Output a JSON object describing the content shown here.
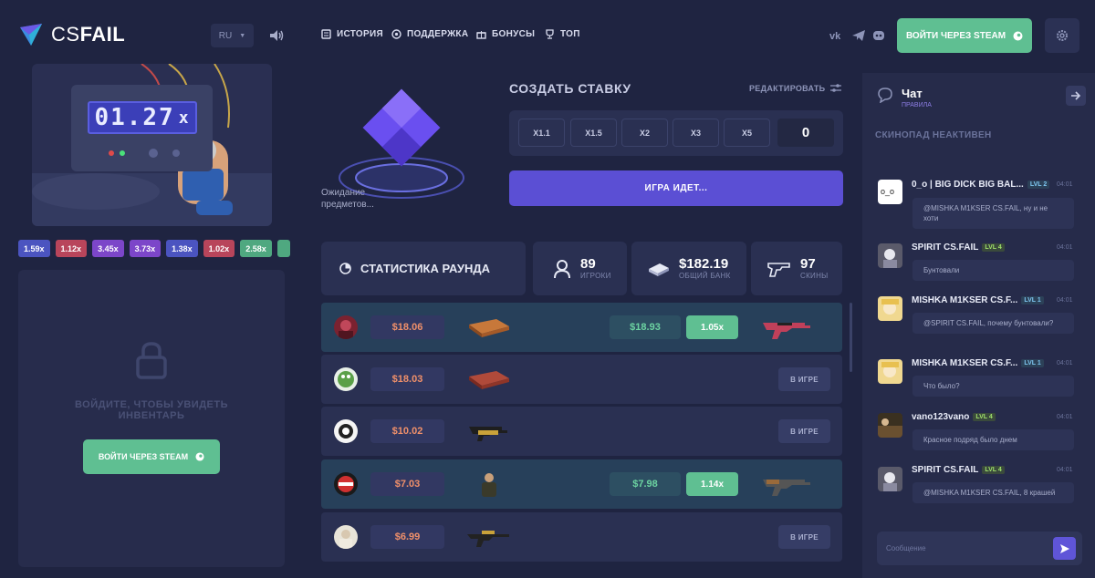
{
  "header": {
    "logo_light": "CS",
    "logo_bold": "FAIL",
    "lang": "RU",
    "nav": [
      {
        "label": "ИСТОРИЯ",
        "icon": "history-icon"
      },
      {
        "label": "ПОДДЕРЖКА",
        "icon": "support-icon"
      },
      {
        "label": "БОНУСЫ",
        "icon": "gift-icon"
      },
      {
        "label": "ТОП",
        "icon": "trophy-icon"
      }
    ],
    "social": [
      "vk-icon",
      "telegram-icon",
      "discord-icon"
    ],
    "steam_login": "ВОЙТИ ЧЕРЕЗ STEAM"
  },
  "game": {
    "multiplier": "01.27",
    "multiplier_suffix": "x",
    "history": [
      {
        "value": "1.59x",
        "color": "#4b54c0"
      },
      {
        "value": "1.12x",
        "color": "#b8455b"
      },
      {
        "value": "3.45x",
        "color": "#7c46c9"
      },
      {
        "value": "3.73x",
        "color": "#7c46c9"
      },
      {
        "value": "1.38x",
        "color": "#4b54c0"
      },
      {
        "value": "1.02x",
        "color": "#b8455b"
      },
      {
        "value": "2.58x",
        "color": "#4fa880"
      }
    ]
  },
  "inventory": {
    "login_text_1": "ВОЙДИТЕ, ЧТОБЫ УВИДЕТЬ",
    "login_text_2": "ИНВЕНТАРЬ",
    "steam_login": "ВОЙТИ ЧЕРЕЗ STEAM"
  },
  "bet": {
    "waiting_1": "Ожидание",
    "waiting_2": "предметов...",
    "title": "СОЗДАТЬ СТАВКУ",
    "edit": "РЕДАКТИРОВАТЬ",
    "multipliers": [
      "X1.1",
      "X1.5",
      "X2",
      "X3",
      "X5"
    ],
    "amount": "0",
    "game_status": "ИГРА ИДЕТ..."
  },
  "stats": {
    "title": "СТАТИСТИКА РАУНДА",
    "players_value": "89",
    "players_label": "ИГРОКИ",
    "bank_value": "$182.19",
    "bank_label": "ОБЩИЙ БАНК",
    "skins_value": "97",
    "skins_label": "СКИНЫ"
  },
  "bets": [
    {
      "price": "$18.06",
      "win": true,
      "win_price": "$18.93",
      "win_mult": "1.05x"
    },
    {
      "price": "$18.03",
      "win": false,
      "status": "В ИГРЕ"
    },
    {
      "price": "$10.02",
      "win": false,
      "status": "В ИГРЕ"
    },
    {
      "price": "$7.03",
      "win": true,
      "win_price": "$7.98",
      "win_mult": "1.14x"
    },
    {
      "price": "$6.99",
      "win": false,
      "status": "В ИГРЕ"
    }
  ],
  "chat": {
    "title": "Чат",
    "rules": "ПРАВИЛА",
    "skinopad": "СКИНОПАД НЕАКТИВЕН",
    "placeholder": "Сообщение",
    "messages": [
      {
        "name": "0_o | BIG DICK BIG BAL...",
        "lvl": "LVL 2",
        "time": "04:01",
        "text": "@MISHKA M1KSER CS.FAIL, ну и не хоти"
      },
      {
        "name": "SPIRIT CS.FAIL",
        "lvl": "LVL 4",
        "time": "04:01",
        "text": "Бунтовали"
      },
      {
        "name": "MISHKA M1KSER CS.F...",
        "lvl": "LVL 1",
        "time": "04:01",
        "text": "@SPIRIT CS.FAIL, почему бунтовали?"
      },
      {
        "name": "MISHKA M1KSER CS.F...",
        "lvl": "LVL 1",
        "time": "04:01",
        "text": "Что было?"
      },
      {
        "name": "vano123vano",
        "lvl": "LVL 4",
        "time": "04:01",
        "text": "Красное подряд было днем"
      },
      {
        "name": "SPIRIT CS.FAIL",
        "lvl": "LVL 4",
        "time": "04:01",
        "text": "@MISHKA M1KSER CS.FAIL, 8 крашей"
      }
    ]
  }
}
